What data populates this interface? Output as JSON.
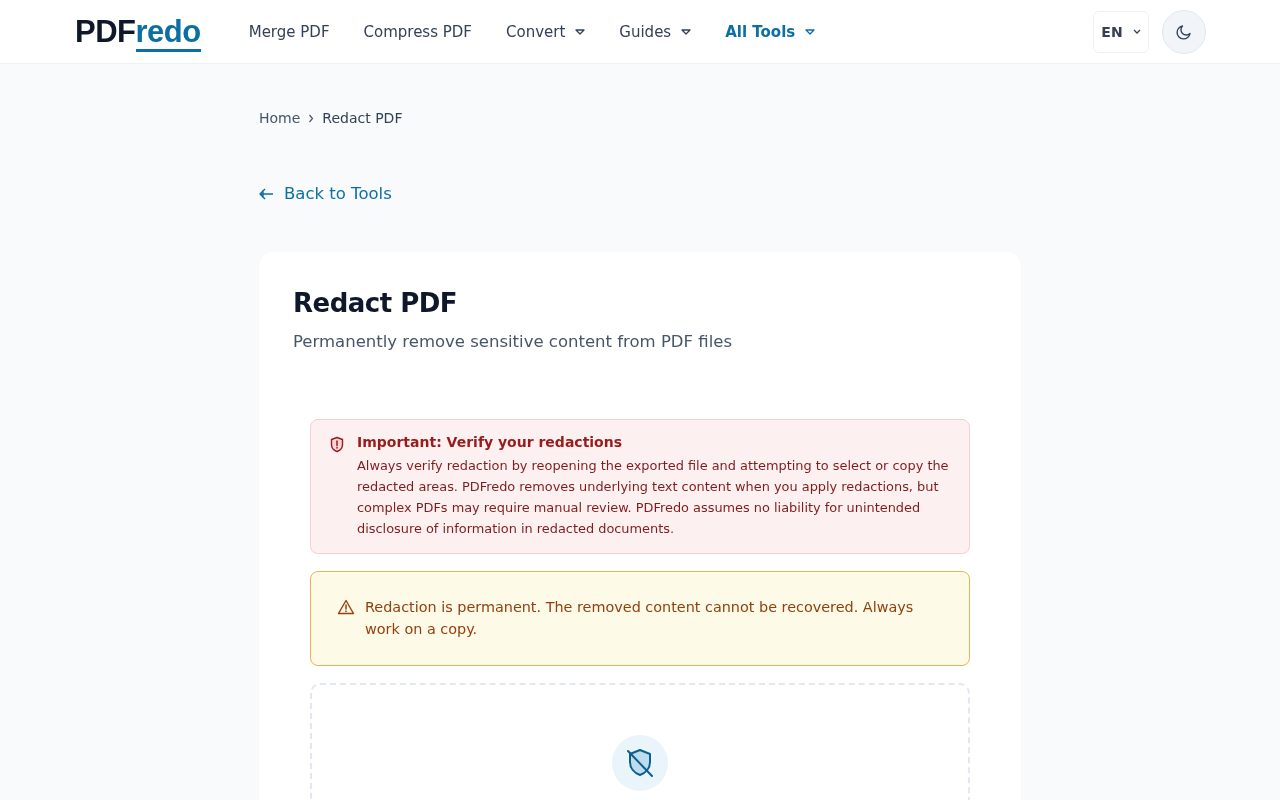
{
  "header": {
    "logo": {
      "dark": "PDF",
      "accent": "redo"
    },
    "nav": [
      {
        "label": "Merge PDF",
        "dropdown": false,
        "selected": false
      },
      {
        "label": "Compress PDF",
        "dropdown": false,
        "selected": false
      },
      {
        "label": "Convert",
        "dropdown": true,
        "selected": false
      },
      {
        "label": "Guides",
        "dropdown": true,
        "selected": false
      },
      {
        "label": "All Tools",
        "dropdown": true,
        "selected": true
      }
    ],
    "language": "EN"
  },
  "breadcrumb": [
    {
      "label": "Home"
    },
    {
      "label": "Redact PDF"
    }
  ],
  "back_link": "Back to Tools",
  "card": {
    "title": "Redact PDF",
    "subtitle": "Permanently remove sensitive content from PDF files",
    "alerts": [
      {
        "kind": "danger",
        "title": "Important: Verify your redactions",
        "text": "Always verify redaction by reopening the exported file and attempting to select or copy the redacted areas. PDFredo removes underlying text content when you apply redactions, but complex PDFs may require manual review. PDFredo assumes no liability for unintended disclosure of information in redacted documents."
      },
      {
        "kind": "warning",
        "text": "Redaction is permanent. The removed content cannot be recovered. Always work on a copy."
      }
    ]
  }
}
